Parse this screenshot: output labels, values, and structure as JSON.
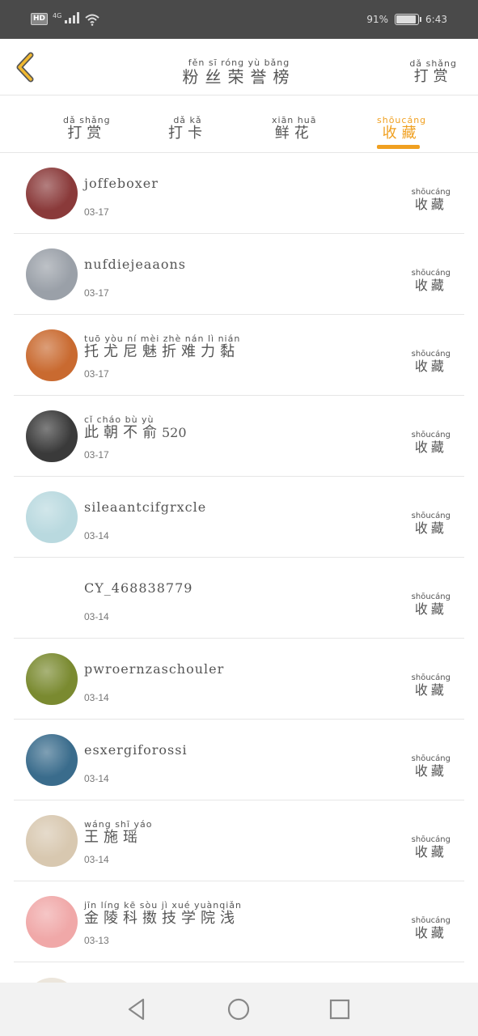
{
  "status": {
    "hd": "HD",
    "network": "4G",
    "battery": "91%",
    "time": "6:43",
    "battery_level": 0.91
  },
  "header": {
    "title_pinyin": "fěn  sī  róng  yù  bǎng",
    "title": "粉丝荣誉榜",
    "action_pinyin": "dǎ  shǎng",
    "action": "打赏"
  },
  "tabs": [
    {
      "pinyin": "dǎ  shǎng",
      "label": "打赏",
      "active": false
    },
    {
      "pinyin": "dǎ   kǎ",
      "label": "打卡",
      "active": false
    },
    {
      "pinyin": "xiān huā",
      "label": "鲜花",
      "active": false
    },
    {
      "pinyin": "shōucáng",
      "label": "收藏",
      "active": true
    }
  ],
  "row_action": {
    "pinyin": "shōucáng",
    "label": "收藏"
  },
  "rows": [
    {
      "name": "joffeboxer",
      "date": "03-17",
      "avatar_color": "#8a3a3a",
      "avatar_icon": "skull-avatar-icon"
    },
    {
      "name": "nufdiejeaaons",
      "date": "03-17",
      "avatar_color": "#9aa0a8",
      "avatar_icon": "dark-figure-avatar-icon"
    },
    {
      "name_pinyin": "tuō  yòu  ní   mèi  zhè  nán   lì  nián",
      "name": "托尤尼魅折难力黏",
      "date": "03-17",
      "avatar_color": "#c96a30",
      "avatar_icon": "cartoon-avatar-icon"
    },
    {
      "name_pinyin": "cǐ  cháo  bù   yù",
      "name": "此朝不俞",
      "name_suffix": "520",
      "date": "03-17",
      "avatar_color": "#3a3a3a",
      "avatar_icon": "person-avatar-icon"
    },
    {
      "name": "sileaantcifgrxcle",
      "date": "03-14",
      "avatar_color": "#b9d9df",
      "avatar_icon": "girl-avatar-icon"
    },
    {
      "name": "CY_468838779",
      "date": "03-14",
      "avatar_color": "#ffffff",
      "avatar_icon": "anime-boy-avatar-icon"
    },
    {
      "name": "pwroernzaschouler",
      "date": "03-14",
      "avatar_color": "#7a8a30",
      "avatar_icon": "flower-avatar-icon"
    },
    {
      "name": "esxergiforossi",
      "date": "03-14",
      "avatar_color": "#3a6c8c",
      "avatar_icon": "sea-avatar-icon"
    },
    {
      "name_pinyin": "wáng shī  yáo",
      "name": "王施瑶",
      "date": "03-14",
      "avatar_color": "#d8c8b0",
      "avatar_icon": "illustration-avatar-icon"
    },
    {
      "name_pinyin": "jīn  líng  kē   sòu   jì   xué yuànqiǎn",
      "name": "金陵科擞技学院浅",
      "date": "03-13",
      "avatar_color": "#f0a8a8",
      "avatar_icon": "letter-r-avatar-icon"
    }
  ],
  "nav": {
    "back": "back-nav-icon",
    "home": "home-nav-icon",
    "recents": "recents-nav-icon"
  },
  "colors": {
    "accent": "#f0a020",
    "status_bar": "#4a4a4a",
    "divider": "#e6e6e6"
  }
}
